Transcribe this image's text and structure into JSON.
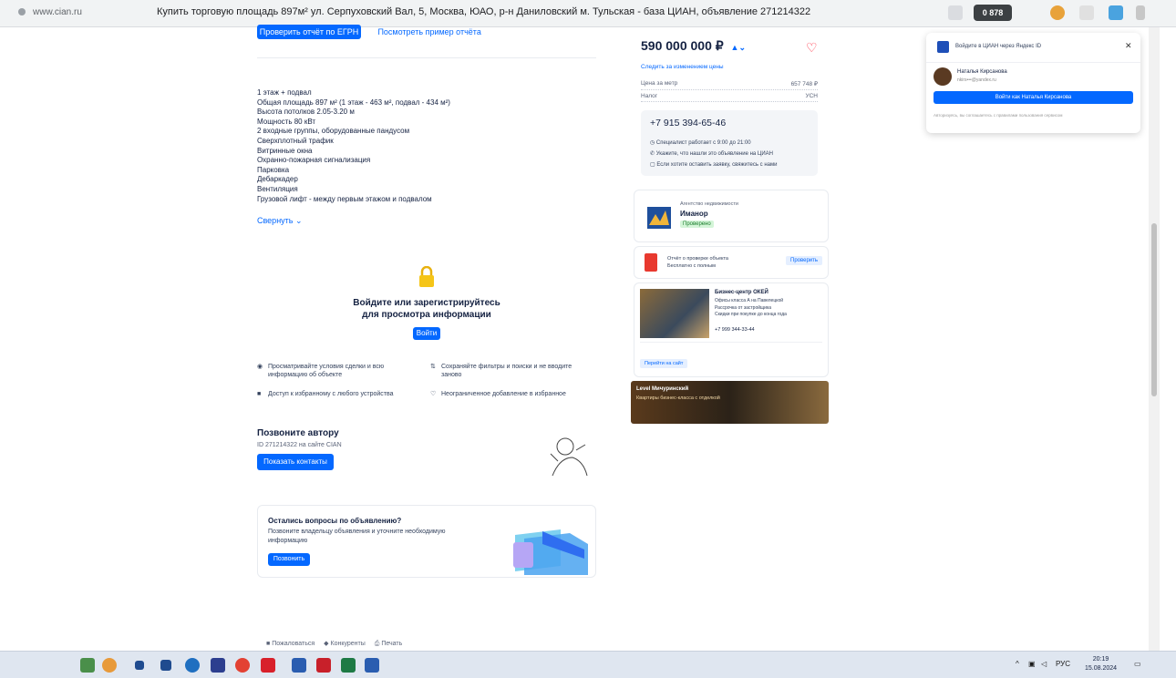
{
  "browser": {
    "url": "www.cian.ru",
    "tab_title": "Купить торговую площадь 897м² ул. Серпуховский Вал, 5, Москва, ЮАО, р-н Даниловский м. Тульская - база ЦИАН, объявление 271214322",
    "badge": "0 878"
  },
  "top": {
    "primary_button": "Проверить отчёт по ЕГРН",
    "secondary_link": "Посмотреть пример отчёта"
  },
  "description": {
    "lines": [
      "1 этаж + подвал",
      "Общая площадь 897 м² (1 этаж - 463 м², подвал - 434 м²)",
      "Высота потолков 2.05-3.20 м",
      "Мощность 80 кВт",
      "2 входные группы, оборудованные пандусом",
      "Сверхплотный трафик",
      "Витринные окна",
      "Охранно-пожарная сигнализация",
      "Парковка",
      "Дебаркадер",
      "Вентиляция",
      "Грузовой лифт - между первым этажом и подвалом"
    ],
    "collapse_link": "Свернуть"
  },
  "login_gate": {
    "title_line1": "Войдите или зарегистрируйтесь",
    "title_line2": "для просмотра информации",
    "button": "Войти",
    "features": [
      "Просматривайте условия сделки и всю информацию об объекте",
      "Сохраняйте фильтры и поиски и не вводите заново",
      "Доступ к избранному с любого устройства",
      "Неограниченное добавление в избранное"
    ]
  },
  "call_author": {
    "title": "Позвоните автору",
    "subtitle": "ID 271214322 на сайте CIAN",
    "button": "Показать контакты"
  },
  "questions": {
    "title": "Остались вопросы по объявлению?",
    "text_line1": "Позвоните владельцу объявления и уточните необходимую",
    "text_line2": "информацию",
    "button": "Позвонить"
  },
  "footer": {
    "items": [
      "Пожаловаться",
      "Конкуренты",
      "Печать"
    ]
  },
  "price_card": {
    "price": "590 000 000 ₽",
    "sub_link": "Следить за изменением цены",
    "rows": [
      {
        "label": "Цена за метр",
        "value": "657 748 ₽"
      },
      {
        "label": "Налог",
        "value": "УСН"
      }
    ],
    "phone": "+7 915 394-65-46",
    "notes": [
      "Специалист работает с 9:00 до 21:00",
      "Укажите, что нашли это объявление на ЦИАН",
      "Если хотите оставить заявку, свяжитесь с нами"
    ]
  },
  "agency": {
    "label": "Агентство недвижимости",
    "name": "Иманор",
    "badge": "Проверено"
  },
  "report": {
    "text_line1": "Отчёт о проверке объекта",
    "text_line2": "Бесплатно с полным",
    "button": "Проверить"
  },
  "ad_card": {
    "title": "Бизнес-центр ОКЕЙ",
    "lines": [
      "Офисы класса А на Павелецкой",
      "Рассрочка от застройщика",
      "Скидки при покупке до конца года"
    ],
    "phone": "+7 999 344-33-44",
    "button": "Перейти на сайт"
  },
  "banner": {
    "line1": "Level Мичуринский",
    "line2": "Квартиры бизнес-класса с отделкой"
  },
  "notification": {
    "title": "Войдите в ЦИАН через Яндекс ID",
    "user_name": "Наталья Кирсанова",
    "user_email": "nkirs•••@yandex.ru",
    "button": "Войти как Наталья Кирсанова",
    "legal": "Авторизуясь, вы соглашаетесь с правилами пользования сервисом"
  },
  "taskbar": {
    "lang": "РУС",
    "time": "20:19",
    "date": "15.08.2024"
  }
}
